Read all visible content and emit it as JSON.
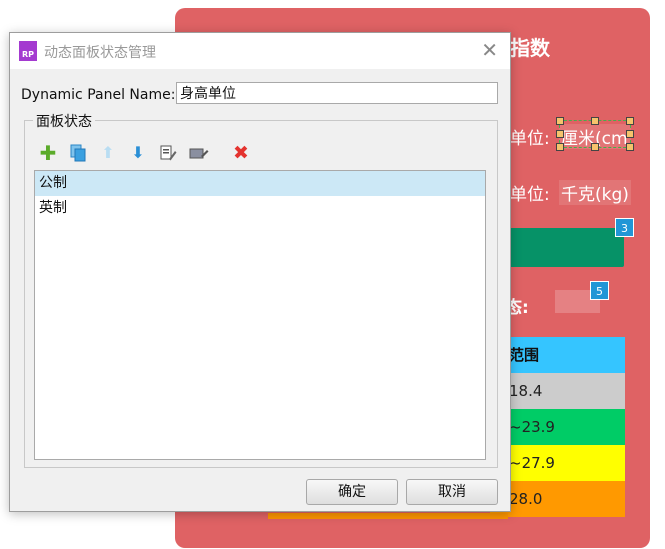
{
  "background": {
    "title_fragment": "指数",
    "height_label_fragment": "单位:",
    "height_unit_value": "厘米(cm",
    "weight_label_fragment": "单位:",
    "weight_unit_value": "千克(kg)",
    "status_label_fragment": "态:",
    "badges": [
      "3",
      "5"
    ],
    "bmi_table": {
      "header": "范围",
      "rows": [
        "18.4",
        "~23.9",
        "~27.9",
        "28.0"
      ],
      "colors": [
        "#35c5ff",
        "#cccccc",
        "#00cc66",
        "#ffff00",
        "#ff9900"
      ]
    }
  },
  "dialog": {
    "title": "动态面板状态管理",
    "app_icon_text": "RP",
    "name_label": "Dynamic Panel Name:",
    "name_value": "身高单位",
    "states_group_label": "面板状态",
    "toolbar_icons": [
      "add-icon",
      "duplicate-icon",
      "move-up-icon",
      "move-down-icon",
      "edit-state-icon",
      "edit-all-icon",
      "delete-icon"
    ],
    "states": [
      "公制",
      "英制"
    ],
    "selected_state": "公制",
    "ok_label": "确定",
    "cancel_label": "取消"
  }
}
